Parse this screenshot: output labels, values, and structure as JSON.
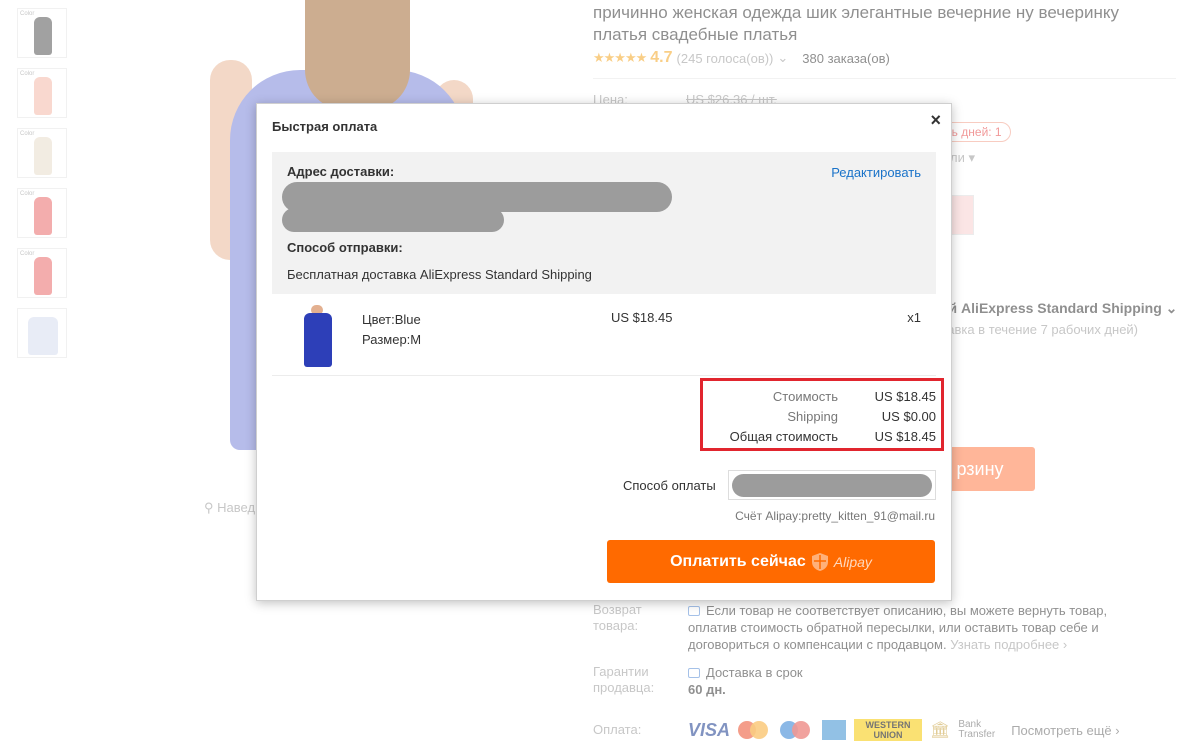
{
  "background": {
    "thumbs": [
      {
        "label": "Color",
        "color": "#555555"
      },
      {
        "label": "Color",
        "color": "#f4b8a8"
      },
      {
        "label": "Color",
        "color": "#e8dccb"
      },
      {
        "label": "Color",
        "color": "#ea6a6a"
      },
      {
        "label": "Color",
        "color": "#ea6a6a"
      },
      {
        "label": "",
        "color": "#8a9ad6"
      }
    ],
    "zoom_hint": "Навед",
    "product_title": "причинно женская одежда шик элегантные вечерние ну вечеринку платья свадебные платья",
    "rating_stars": "★★★★★",
    "rating_value": "4.7",
    "votes": "(245 голоса(ов))",
    "orders": "380 заказа(ов)",
    "price_label": "Цена:",
    "old_price": "US $26.36 / шт.",
    "days_badge": "ось дней: 1",
    "colors_more": "ли",
    "shipping_text": "ой AliExpress Standard Shipping",
    "shipping_sub": "равка в течение 7 рабочих дней)",
    "cart_button": "рзину",
    "return_label": "Возврат товара:",
    "return_text": "Если товар не соответствует описанию, вы можете вернуть товар, оплатив стоимость обратной пересылки, или оставить товар себе и договориться о компенсации с продавцом.",
    "return_more": "Узнать подробнее ›",
    "guarantee_label": "Гарантии продавца:",
    "guarantee_text": "Доставка в срок",
    "guarantee_days": "60 дн.",
    "payment_label": "Оплата:",
    "visa": "VISA",
    "wu_line1": "WESTERN",
    "wu_line2": "UNION",
    "bank_line1": "Bank",
    "bank_line2": "Transfer",
    "see_more": "Посмотреть ещё ›"
  },
  "modal": {
    "title": "Быстрая оплата",
    "close": "×",
    "address_label": "Адрес доставки:",
    "edit": "Редактировать",
    "shipping_method_label": "Способ отправки:",
    "shipping_method_value": "Бесплатная доставка AliExpress Standard Shipping",
    "item": {
      "color": "Цвет:Blue",
      "size": "Размер:M",
      "price": "US $18.45",
      "qty": "x1"
    },
    "summary": [
      {
        "label": "Стоимость",
        "value": "US $18.45"
      },
      {
        "label": "Shipping",
        "value": "US $0.00"
      },
      {
        "label": "Общая стоимость",
        "value": "US $18.45"
      }
    ],
    "payment_method_label": "Способ оплаты",
    "account": "Счёт Alipay:pretty_kitten_91@mail.ru",
    "pay_button": "Оплатить сейчас",
    "alipay": "Alipay"
  },
  "colors": {
    "accent": "#ff6a00",
    "link": "#1a73c9",
    "highlight": "#e1252e",
    "rating": "#f5a623"
  }
}
